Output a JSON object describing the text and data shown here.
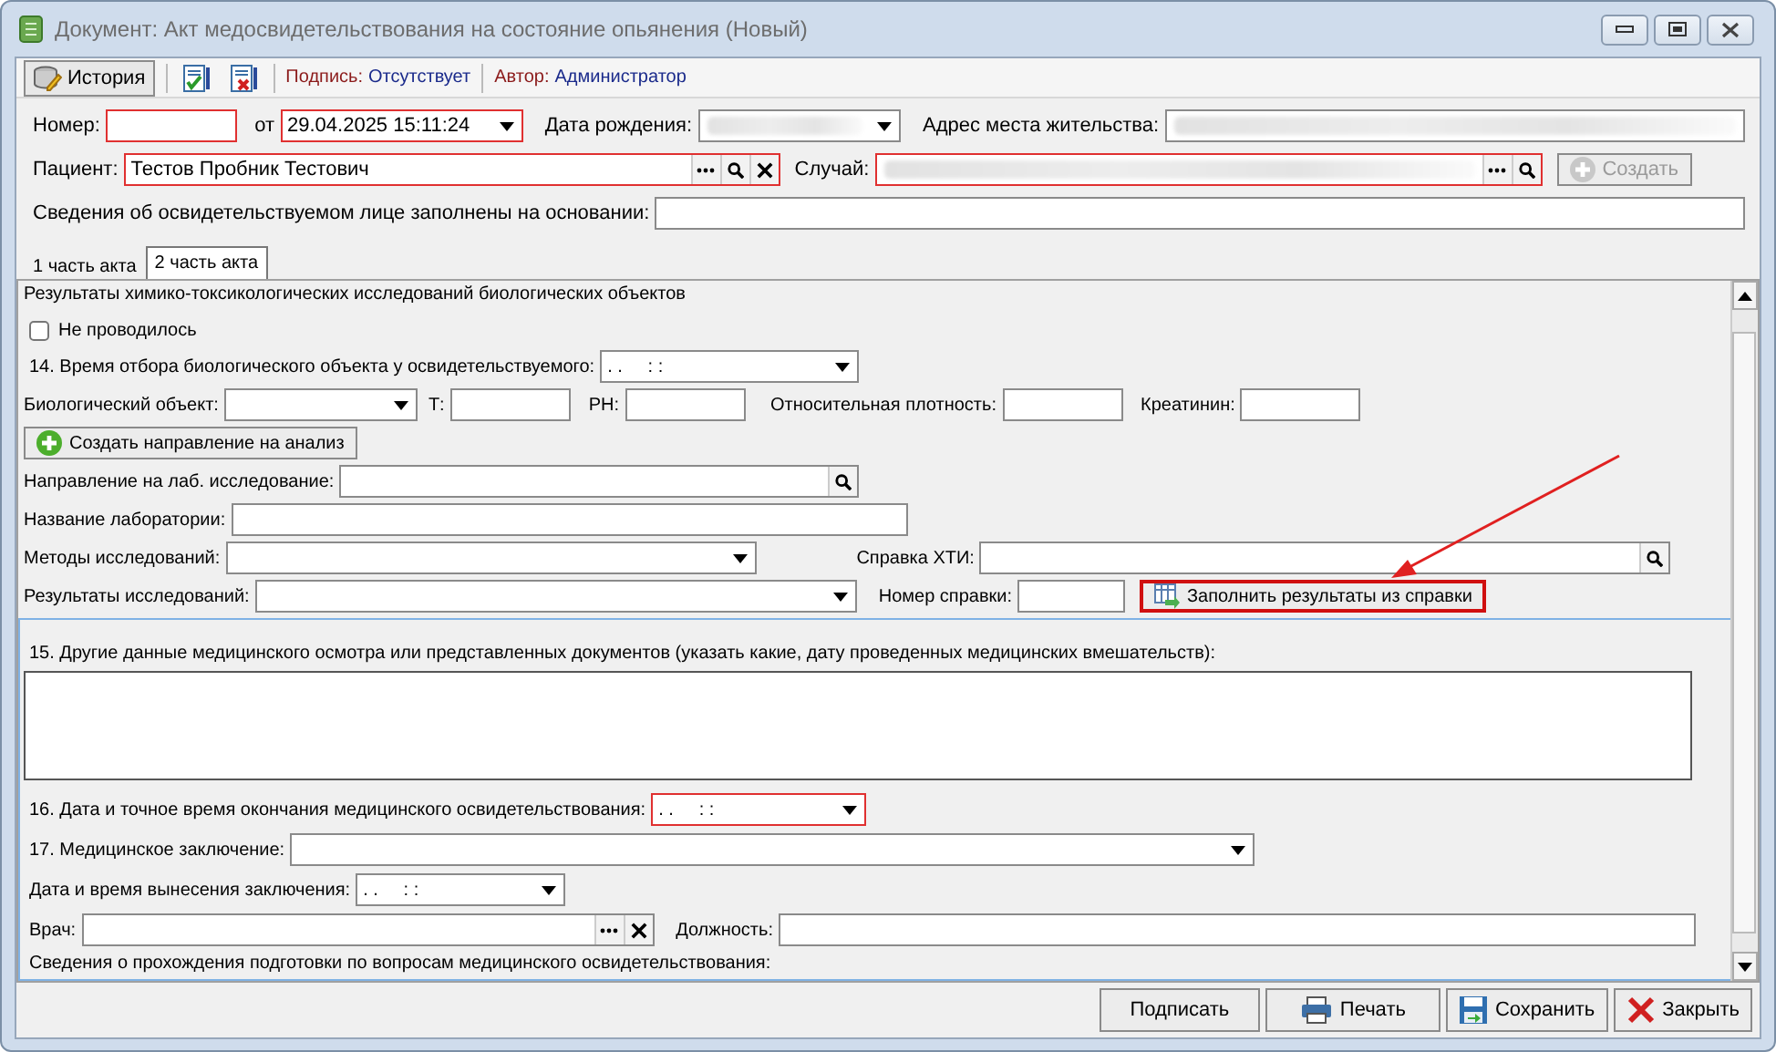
{
  "window": {
    "title": "Документ: Акт медосвидетельствования на состояние опьянения (Новый)"
  },
  "toolbar": {
    "history_button": "История",
    "signature_label": "Подпись:",
    "signature_value": "Отсутствует",
    "author_label": "Автор:",
    "author_value": "Администратор"
  },
  "header": {
    "rows": [
      [
        {
          "kind": "text",
          "label": "Номер:",
          "required": true
        },
        {
          "kind": "combo",
          "label": "от",
          "value": "29.04.2025 15:11:24",
          "required": true
        },
        {
          "kind": "combo",
          "label": "Дата рождения:",
          "blurred": true
        },
        {
          "kind": "text",
          "label": "Адрес места жительства:",
          "blurred": true
        }
      ],
      [
        {
          "kind": "lookup",
          "label": "Пациент:",
          "value": "Тестов Пробник Тестович",
          "required": true
        },
        {
          "kind": "lookup",
          "label": "Случай:",
          "required": true,
          "blurred": true
        },
        {
          "kind": "action",
          "label": "Создать",
          "disabled": true
        }
      ],
      [
        {
          "kind": "text",
          "label": "Сведения об освидетельствуемом лице заполнены на основании:"
        }
      ]
    ]
  },
  "tabs": [
    {
      "label": "1 часть акта",
      "selected": false
    },
    {
      "label": "2 часть акта",
      "selected": true
    }
  ],
  "section_title": "Результаты химико-токсикологических исследований биологических объектов",
  "not_performed": {
    "label": "Не проводилось",
    "checked": false
  },
  "lab_rows": [
    [
      {
        "kind": "combo",
        "label": "14. Время отбора биологического объекта у освидетельствуемого:",
        "value": ". .     : :"
      }
    ],
    [
      {
        "kind": "combo",
        "label": "Биологический объект:"
      },
      {
        "kind": "text",
        "label": "Т:"
      },
      {
        "kind": "text",
        "label": "PH:"
      },
      {
        "kind": "text",
        "label": "Относительная плотность:"
      },
      {
        "kind": "text",
        "label": "Креатинин:"
      }
    ],
    [
      {
        "kind": "action",
        "label": "Создать направление на анализ"
      }
    ],
    [
      {
        "kind": "lookup",
        "label": "Направление на лаб. исследование:"
      }
    ],
    [
      {
        "kind": "text",
        "label": "Название лаборатории:"
      }
    ],
    [
      {
        "kind": "combo",
        "label": "Методы исследований:"
      },
      {
        "kind": "lookup",
        "label": "Справка ХТИ:"
      }
    ],
    [
      {
        "kind": "combo",
        "label": "Результаты исследований:"
      },
      {
        "kind": "text",
        "label": "Номер справки:"
      },
      {
        "kind": "action",
        "label": "Заполнить результаты из справки",
        "highlighted": true
      }
    ]
  ],
  "exam": {
    "other_data_label": "15. Другие данные медицинского осмотра или представленных документов (указать какие, дату проведенных медицинских вмешательств):",
    "rows": [
      [
        {
          "kind": "combo",
          "label": "16. Дата и точное время окончания медицинского освидетельствования:",
          "value": ". .     : :",
          "required": true
        }
      ],
      [
        {
          "kind": "combo",
          "label": "17. Медицинское заключение:"
        }
      ],
      [
        {
          "kind": "combo",
          "label": "Дата и время вынесения заключения:",
          "value": ". .     : :"
        }
      ],
      [
        {
          "kind": "lookup",
          "label": "Врач:"
        },
        {
          "kind": "text",
          "label": "Должность:"
        }
      ]
    ],
    "training_label": "Сведения о прохождения подготовки по вопросам медицинского освидетельствования:"
  },
  "footer_buttons": [
    {
      "label": "Подписать"
    },
    {
      "label": "Печать"
    },
    {
      "label": "Сохранить"
    },
    {
      "label": "Закрыть"
    }
  ]
}
